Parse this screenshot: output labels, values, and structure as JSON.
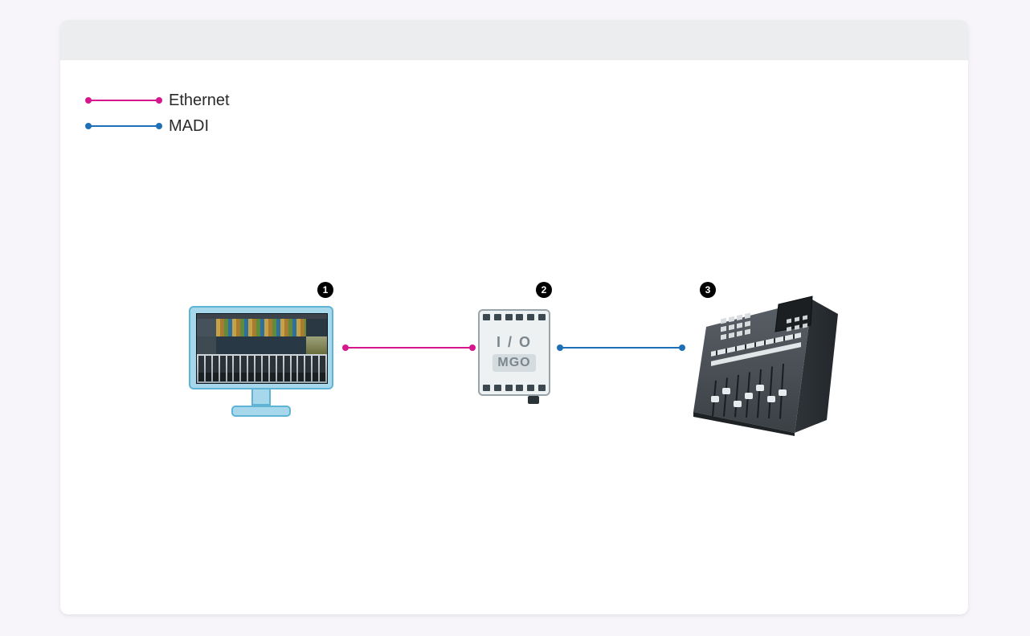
{
  "legend": {
    "ethernet_label": "Ethernet",
    "madi_label": "MADI"
  },
  "nodes": {
    "1": {
      "badge": "1",
      "type": "monitor-workstation"
    },
    "2": {
      "badge": "2",
      "type": "io-interface",
      "line1": "I / O",
      "line2": "MGO"
    },
    "3": {
      "badge": "3",
      "type": "mixing-console"
    }
  },
  "connections": [
    {
      "from": 1,
      "to": 2,
      "protocol": "Ethernet",
      "color": "#d6168d"
    },
    {
      "from": 2,
      "to": 3,
      "protocol": "MADI",
      "color": "#1d6fb8"
    }
  ],
  "colors": {
    "ethernet": "#d6168d",
    "madi": "#1d6fb8",
    "monitor_body": "#a7d7ea",
    "monitor_border": "#5fb4d6",
    "io_border": "#98a4aa",
    "console_body": "#4c5258"
  }
}
